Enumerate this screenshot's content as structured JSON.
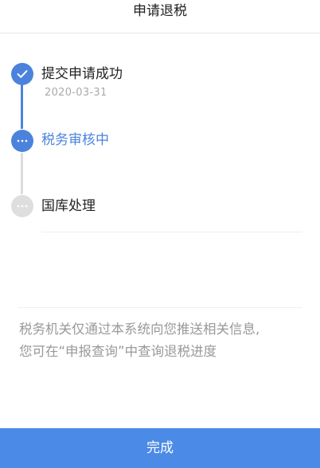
{
  "header": {
    "title": "申请退税"
  },
  "timeline": {
    "steps": [
      {
        "label": "提交申请成功",
        "date": "2020-03-31",
        "status": "done",
        "icon": "check-icon"
      },
      {
        "label": "税务审核中",
        "status": "active",
        "icon": "ellipsis-icon"
      },
      {
        "label": "国库处理",
        "status": "pending",
        "icon": "ellipsis-icon"
      }
    ]
  },
  "notice": {
    "line1": "税务机关仅通过本系统向您推送相关信息,",
    "line2": "您可在“申报查询”中查询退税进度"
  },
  "footer": {
    "done_label": "完成"
  },
  "colors": {
    "accent": "#4b83dc",
    "button": "#4b8ae6",
    "pending": "#dedede",
    "muted_text": "#999999"
  }
}
